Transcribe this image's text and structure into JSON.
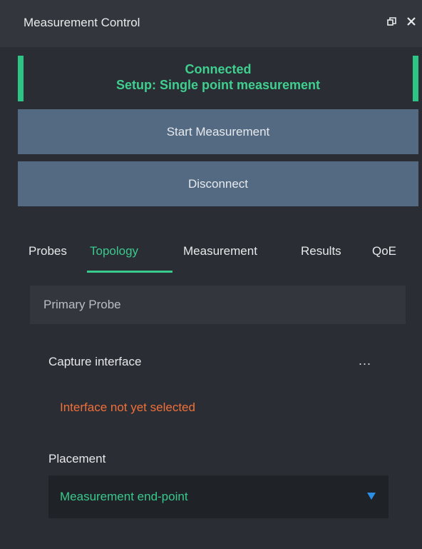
{
  "window": {
    "title": "Measurement Control",
    "icons": [
      "restore-icon",
      "close-icon"
    ]
  },
  "status": {
    "line1": "Connected",
    "line2": "Setup: Single point measurement",
    "color": "#3fd08f"
  },
  "buttons": {
    "start": "Start Measurement",
    "disconnect": "Disconnect"
  },
  "tabs": [
    {
      "label": "Probes",
      "active": false
    },
    {
      "label": "Topology",
      "active": true
    },
    {
      "label": "Measurement",
      "active": false
    },
    {
      "label": "Results",
      "active": false
    },
    {
      "label": "QoE",
      "active": false
    }
  ],
  "topology": {
    "section_title": "Primary Probe",
    "capture_label": "Capture interface",
    "capture_more": "...",
    "warning": "Interface not yet selected",
    "placement_label": "Placement",
    "placement_value": "Measurement end-point"
  },
  "colors": {
    "accent_green": "#39c98d",
    "warning_orange": "#f0703a",
    "button_blue": "#546a82",
    "dropdown_arrow": "#2b8fe6"
  }
}
